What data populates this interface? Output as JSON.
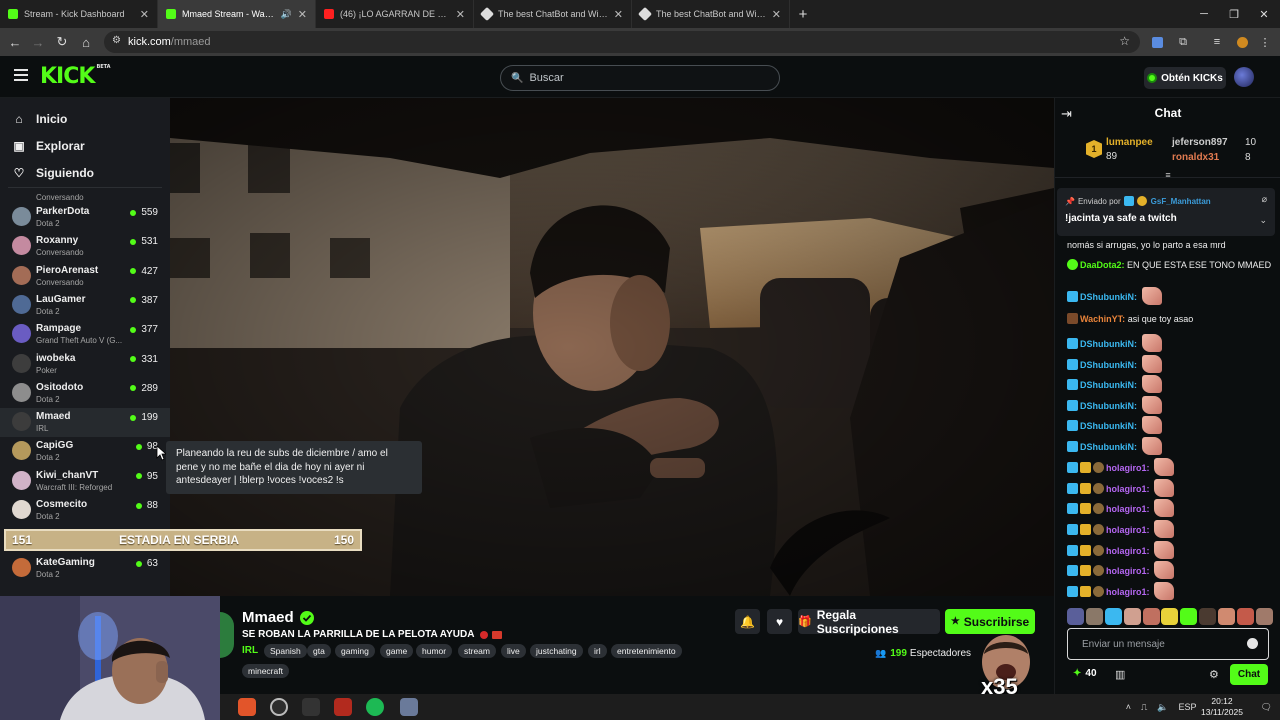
{
  "browser": {
    "tabs": [
      {
        "title": "Stream - Kick Dashboard",
        "fav": "#53fc18",
        "active": false
      },
      {
        "title": "Mmaed Stream - Watch Live",
        "fav": "#53fc18",
        "active": true
      },
      {
        "title": "(46) ¡LO AGARRAN DE SAN",
        "fav": "#ff2020",
        "active": false
      },
      {
        "title": "The best ChatBot and Widgets",
        "fav": "#dddddd",
        "active": false
      },
      {
        "title": "The best ChatBot and Widgets",
        "fav": "#dddddd",
        "active": false
      }
    ],
    "url_host": "kick.com",
    "url_path": "/mmaed"
  },
  "header": {
    "logo": "KICK",
    "logo_badge": "BETA",
    "search_placeholder": "Buscar",
    "kicks_button": "Obtén KICKs"
  },
  "sidebar": {
    "nav": [
      "Inicio",
      "Explorar",
      "Siguiendo"
    ],
    "cut_label": "Conversando",
    "channels": [
      {
        "name": "ParkerDota",
        "game": "Dota 2",
        "viewers": "559",
        "color": "#7a8b9a"
      },
      {
        "name": "Roxanny",
        "game": "Conversando",
        "viewers": "531",
        "color": "#c48aa0"
      },
      {
        "name": "PieroArenast",
        "game": "Conversando",
        "viewers": "427",
        "color": "#a36c56"
      },
      {
        "name": "LauGamer",
        "game": "Dota 2",
        "viewers": "387",
        "color": "#4f6a95"
      },
      {
        "name": "Rampage",
        "game": "Grand Theft Auto V (G...",
        "viewers": "377",
        "color": "#6a5cc2"
      },
      {
        "name": "iwobeka",
        "game": "Poker",
        "viewers": "331",
        "color": "#3d3d3d"
      },
      {
        "name": "Ositodoto",
        "game": "Dota 2",
        "viewers": "289",
        "color": "#8d8d8d"
      },
      {
        "name": "Mmaed",
        "game": "IRL",
        "viewers": "199",
        "color": "#3c3c3c"
      },
      {
        "name": "CapiGG",
        "game": "Dota 2",
        "viewers": "98",
        "color": "#b5995c"
      },
      {
        "name": "Kiwi_chanVT",
        "game": "Warcraft III: Reforged",
        "viewers": "95",
        "color": "#d1b3c8"
      },
      {
        "name": "Cosmecito",
        "game": "Dota 2",
        "viewers": "88",
        "color": "#e0d8d0"
      },
      {
        "name": "KateGaming",
        "game": "Dota 2",
        "viewers": "63",
        "color": "#c46b3a"
      }
    ]
  },
  "tooltip": "Planeando la reu de subs de diciembre / amo el pene y no me bañe el dia de hoy ni ayer ni antesdeayer | !blerp !voces !voces2 !s",
  "goal_bar": {
    "left": "151",
    "center": "ESTADIA EN SERBIA",
    "right": "150"
  },
  "stream": {
    "name": "Mmaed",
    "title": "SE ROBAN LA PARRILLA DE LA PELOTA AYUDA",
    "category": "IRL",
    "tags": [
      "Spanish",
      "gta",
      "gaming",
      "game",
      "humor",
      "stream",
      "live",
      "justchating",
      "irl",
      "entretenimiento",
      "minecraft"
    ],
    "viewers": "199",
    "viewers_label": "Espectadores",
    "gift_label": "Regala Suscripciones",
    "sub_label": "Suscribirse",
    "meme_text": "x35"
  },
  "chat": {
    "title": "Chat",
    "leaderboard": [
      {
        "rank": "1",
        "name": "lumanpee",
        "value": "89"
      },
      {
        "name": "jeferson897",
        "value": "10"
      },
      {
        "name": "ronaldx31",
        "value": "8"
      }
    ],
    "pinned": {
      "by_label": "Enviado por",
      "by_user": "GsF_Manhattan",
      "message": "!jacinta ya safe a twitch"
    },
    "messages": [
      {
        "user": "",
        "text": "nomás si arrugas, yo lo parto a esa mrd",
        "color": "#eeeeee",
        "emote": false
      },
      {
        "user": "DaaDota2:",
        "text": "EN QUE ESTA ESE TONO MMAED",
        "color": "#53fc18",
        "emote": false
      },
      {
        "user": "DShubunkiN:",
        "text": "",
        "color": "#3bb8f0",
        "emote": true
      },
      {
        "user": "WachinYT:",
        "text": "asi que toy asao",
        "color": "#e8833a",
        "emote": false
      },
      {
        "user": "DShubunkiN:",
        "text": "",
        "color": "#3bb8f0",
        "emote": true
      },
      {
        "user": "DShubunkiN:",
        "text": "",
        "color": "#3bb8f0",
        "emote": true
      },
      {
        "user": "DShubunkiN:",
        "text": "",
        "color": "#3bb8f0",
        "emote": true
      },
      {
        "user": "DShubunkiN:",
        "text": "",
        "color": "#3bb8f0",
        "emote": true
      },
      {
        "user": "DShubunkiN:",
        "text": "",
        "color": "#3bb8f0",
        "emote": true
      },
      {
        "user": "DShubunkiN:",
        "text": "",
        "color": "#3bb8f0",
        "emote": true
      },
      {
        "user": "holagiro1:",
        "text": "",
        "color": "#b366f0",
        "emote": true
      },
      {
        "user": "holagiro1:",
        "text": "",
        "color": "#b366f0",
        "emote": true
      },
      {
        "user": "holagiro1:",
        "text": "",
        "color": "#b366f0",
        "emote": true
      },
      {
        "user": "holagiro1:",
        "text": "",
        "color": "#b366f0",
        "emote": true
      },
      {
        "user": "holagiro1:",
        "text": "",
        "color": "#b366f0",
        "emote": true
      },
      {
        "user": "holagiro1:",
        "text": "",
        "color": "#b366f0",
        "emote": true
      },
      {
        "user": "holagiro1:",
        "text": "",
        "color": "#b366f0",
        "emote": true
      }
    ],
    "input_placeholder": "Enviar un mensaje",
    "points": "40",
    "send_label": "Chat"
  },
  "taskbar": {
    "lang": "ESP",
    "time": "20:12",
    "date": "13/11/2025"
  },
  "colors": {
    "accent": "#53fc18",
    "bg": "#0b0e0f",
    "sidebar": "#191b1f"
  }
}
